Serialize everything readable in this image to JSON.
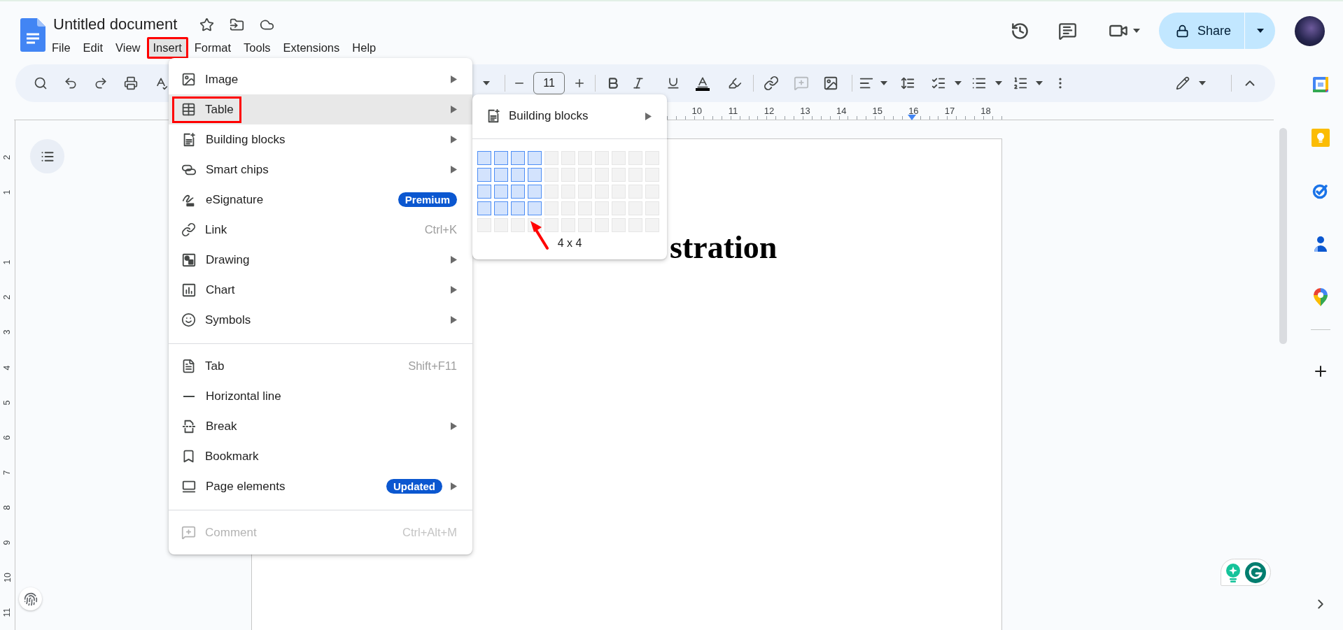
{
  "document": {
    "title": "Untitled document"
  },
  "menu_bar": [
    {
      "label": "File",
      "selected": false,
      "annotated": false
    },
    {
      "label": "Edit",
      "selected": false,
      "annotated": false
    },
    {
      "label": "View",
      "selected": false,
      "annotated": false
    },
    {
      "label": "Insert",
      "selected": true,
      "annotated": true
    },
    {
      "label": "Format",
      "selected": false,
      "annotated": false
    },
    {
      "label": "Tools",
      "selected": false,
      "annotated": false
    },
    {
      "label": "Extensions",
      "selected": false,
      "annotated": false
    },
    {
      "label": "Help",
      "selected": false,
      "annotated": false
    }
  ],
  "share_button": {
    "label": "Share"
  },
  "toolbar": {
    "font_size": "11"
  },
  "ruler": {
    "numbers": [
      "10",
      "11",
      "12",
      "13",
      "14",
      "15",
      "16",
      "17",
      "18"
    ]
  },
  "vertical_ruler": {
    "above": [
      "2",
      "1"
    ],
    "below": [
      "1",
      "2",
      "3",
      "4",
      "5",
      "6",
      "7",
      "8",
      "9",
      "10",
      "11"
    ]
  },
  "page": {
    "heading": "stration"
  },
  "insert_menu": {
    "sections": [
      {
        "items": [
          {
            "label": "Image",
            "submenu": true,
            "selected": false,
            "annotated": false,
            "disabled": false
          },
          {
            "label": "Table",
            "submenu": true,
            "selected": true,
            "annotated": true,
            "disabled": false
          },
          {
            "label": "Building blocks",
            "submenu": true,
            "selected": false,
            "annotated": false,
            "disabled": false
          },
          {
            "label": "Smart chips",
            "submenu": true,
            "selected": false,
            "annotated": false,
            "disabled": false
          },
          {
            "label": "eSignature",
            "submenu": false,
            "selected": false,
            "annotated": false,
            "disabled": false,
            "badge": "Premium"
          },
          {
            "label": "Link",
            "submenu": false,
            "selected": false,
            "annotated": false,
            "disabled": false,
            "shortcut": "Ctrl+K"
          },
          {
            "label": "Drawing",
            "submenu": true,
            "selected": false,
            "annotated": false,
            "disabled": false
          },
          {
            "label": "Chart",
            "submenu": true,
            "selected": false,
            "annotated": false,
            "disabled": false
          },
          {
            "label": "Symbols",
            "submenu": true,
            "selected": false,
            "annotated": false,
            "disabled": false
          }
        ]
      },
      {
        "items": [
          {
            "label": "Tab",
            "submenu": false,
            "selected": false,
            "annotated": false,
            "disabled": false,
            "shortcut": "Shift+F11"
          },
          {
            "label": "Horizontal line",
            "submenu": false,
            "selected": false,
            "annotated": false,
            "disabled": false
          },
          {
            "label": "Break",
            "submenu": true,
            "selected": false,
            "annotated": false,
            "disabled": false
          },
          {
            "label": "Bookmark",
            "submenu": false,
            "selected": false,
            "annotated": false,
            "disabled": false
          },
          {
            "label": "Page elements",
            "submenu": true,
            "selected": false,
            "annotated": false,
            "disabled": false,
            "badge": "Updated"
          }
        ]
      },
      {
        "items": [
          {
            "label": "Comment",
            "submenu": false,
            "selected": false,
            "annotated": false,
            "disabled": true,
            "shortcut": "Ctrl+Alt+M"
          }
        ]
      }
    ]
  },
  "table_submenu": {
    "item": {
      "label": "Building blocks",
      "submenu": true
    },
    "grid": {
      "rows": [
        {
          "cells": [
            {
              "selected": true
            },
            {
              "selected": true
            },
            {
              "selected": true
            },
            {
              "selected": true
            },
            {
              "selected": false
            },
            {
              "selected": false
            },
            {
              "selected": false
            },
            {
              "selected": false
            },
            {
              "selected": false
            },
            {
              "selected": false
            },
            {
              "selected": false
            }
          ]
        },
        {
          "cells": [
            {
              "selected": true
            },
            {
              "selected": true
            },
            {
              "selected": true
            },
            {
              "selected": true
            },
            {
              "selected": false
            },
            {
              "selected": false
            },
            {
              "selected": false
            },
            {
              "selected": false
            },
            {
              "selected": false
            },
            {
              "selected": false
            },
            {
              "selected": false
            }
          ]
        },
        {
          "cells": [
            {
              "selected": true
            },
            {
              "selected": true
            },
            {
              "selected": true
            },
            {
              "selected": true
            },
            {
              "selected": false
            },
            {
              "selected": false
            },
            {
              "selected": false
            },
            {
              "selected": false
            },
            {
              "selected": false
            },
            {
              "selected": false
            },
            {
              "selected": false
            }
          ]
        },
        {
          "cells": [
            {
              "selected": true
            },
            {
              "selected": true
            },
            {
              "selected": true
            },
            {
              "selected": true
            },
            {
              "selected": false
            },
            {
              "selected": false
            },
            {
              "selected": false
            },
            {
              "selected": false
            },
            {
              "selected": false
            },
            {
              "selected": false
            },
            {
              "selected": false
            }
          ]
        },
        {
          "cells": [
            {
              "selected": false
            },
            {
              "selected": false
            },
            {
              "selected": false
            },
            {
              "selected": false
            },
            {
              "selected": false
            },
            {
              "selected": false
            },
            {
              "selected": false
            },
            {
              "selected": false
            },
            {
              "selected": false
            },
            {
              "selected": false
            },
            {
              "selected": false
            }
          ]
        }
      ]
    },
    "size_label": "4 x 4"
  }
}
